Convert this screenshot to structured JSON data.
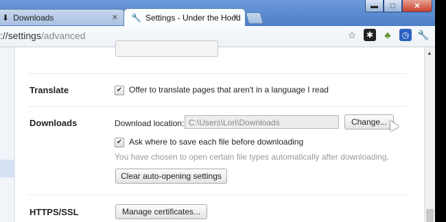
{
  "tabs": [
    {
      "label": "Downloads",
      "icon": "download-icon"
    },
    {
      "label": "Settings - Under the Hood",
      "icon": "wrench-icon"
    }
  ],
  "window_controls": {
    "minimize": "▬",
    "maximize": "□",
    "close": "✕"
  },
  "address": {
    "prefix": "://",
    "host": "settings",
    "path": "/advanced"
  },
  "translate": {
    "title": "Translate",
    "checkbox_label": "Offer to translate pages that aren't in a language I read",
    "checked": true
  },
  "downloads": {
    "title": "Downloads",
    "location_label": "Download location:",
    "location_value": "C:\\Users\\Lori\\Downloads",
    "change_button": "Change...",
    "ask_label": "Ask where to save each file before downloading",
    "ask_checked": true,
    "auto_open_note": "You have chosen to open certain file types automatically after downloading.",
    "clear_button": "Clear auto-opening settings"
  },
  "https": {
    "title": "HTTPS/SSL",
    "manage_button": "Manage certificates..."
  }
}
